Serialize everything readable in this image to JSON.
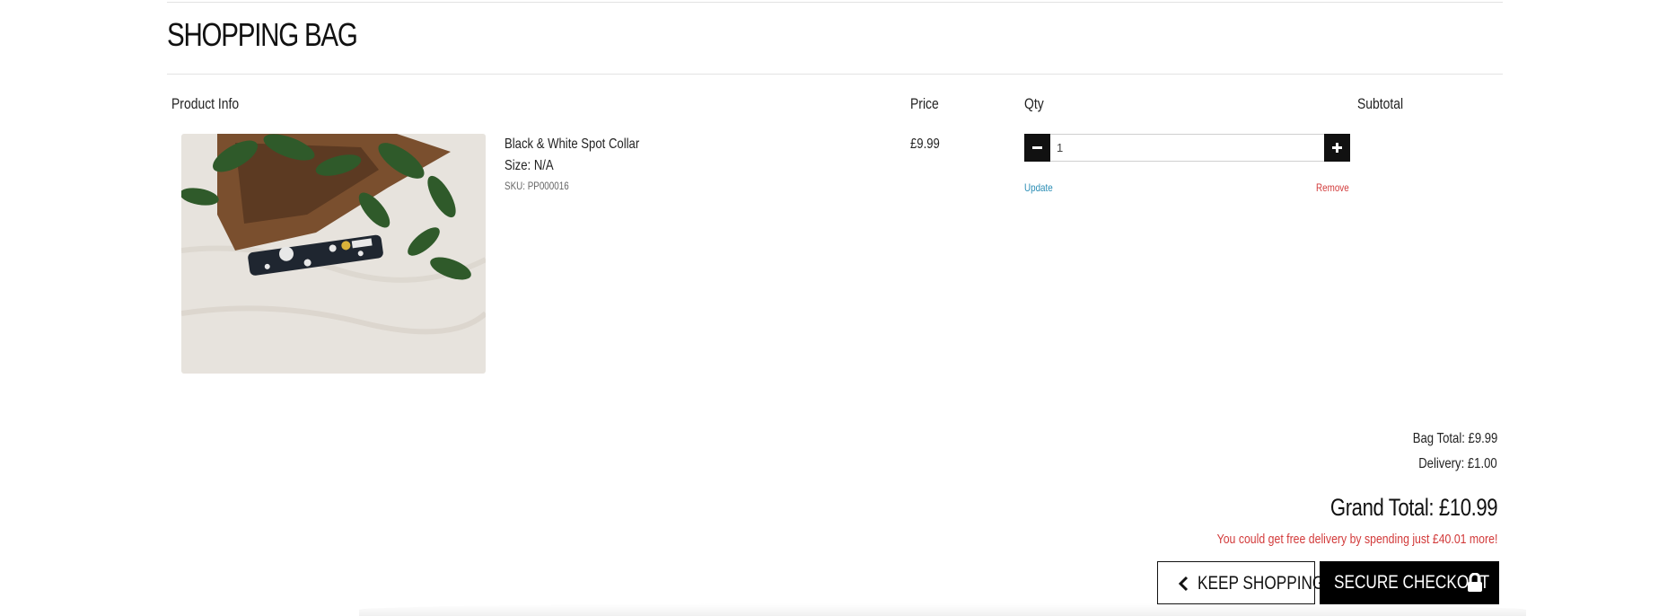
{
  "page": {
    "title": "SHOPPING BAG"
  },
  "table": {
    "headers": {
      "product": "Product Info",
      "price": "Price",
      "qty": "Qty",
      "subtotal": "Subtotal"
    }
  },
  "item": {
    "name": "Black & White Spot Collar",
    "size": "Size: N/A",
    "sku": "SKU: PP000016",
    "price": "£9.99",
    "qty": "1",
    "update_label": "Update",
    "remove_label": "Remove"
  },
  "totals": {
    "bag_total": "Bag Total: £9.99",
    "delivery": "Delivery: £1.00",
    "grand_total": "Grand Total: £10.99",
    "free_delivery_msg": "You could get free delivery by spending just £40.01 more!"
  },
  "actions": {
    "keep_shopping": "KEEP SHOPPING",
    "secure_checkout": "SECURE CHECKOUT"
  },
  "icons": {
    "minus": "minus-icon",
    "plus": "plus-icon",
    "back": "chevron-left-icon",
    "lock": "lock-icon"
  },
  "colors": {
    "accent_link": "#2a8db5",
    "danger": "#d23a3a",
    "button_dark": "#000000"
  }
}
